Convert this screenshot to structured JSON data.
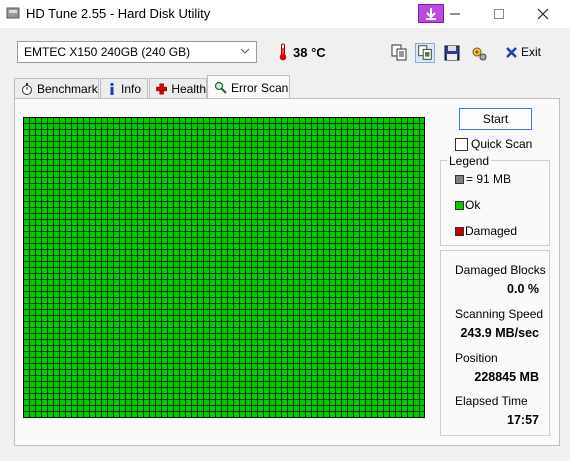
{
  "window": {
    "title": "HD Tune 2.55 - Hard Disk Utility"
  },
  "toolbar": {
    "drive": "EMTEC   X150 240GB (240 GB)",
    "temperature": "38 °C",
    "exit_label": "Exit"
  },
  "tabs": [
    {
      "label": "Benchmark",
      "icon": "stopwatch-icon"
    },
    {
      "label": "Info",
      "icon": "info-icon"
    },
    {
      "label": "Health",
      "icon": "health-cross-icon"
    },
    {
      "label": "Error Scan",
      "icon": "magnifier-icon",
      "active": true
    }
  ],
  "scan": {
    "start_label": "Start",
    "quick_scan_label": "Quick Scan",
    "quick_scan_checked": false,
    "block_color_ok": "#00cc00",
    "block_state": "all-ok"
  },
  "legend": {
    "title": "Legend",
    "items": [
      {
        "label": "= 91 MB",
        "color": "#808080"
      },
      {
        "label": "Ok",
        "color": "#00cc00"
      },
      {
        "label": "Damaged",
        "color": "#cc0000"
      }
    ]
  },
  "stats": {
    "damaged_blocks_label": "Damaged Blocks",
    "damaged_blocks_value": "0.0 %",
    "speed_label": "Scanning Speed",
    "speed_value": "243.9 MB/sec",
    "position_label": "Position",
    "position_value": "228845 MB",
    "elapsed_label": "Elapsed Time",
    "elapsed_value": "17:57"
  }
}
